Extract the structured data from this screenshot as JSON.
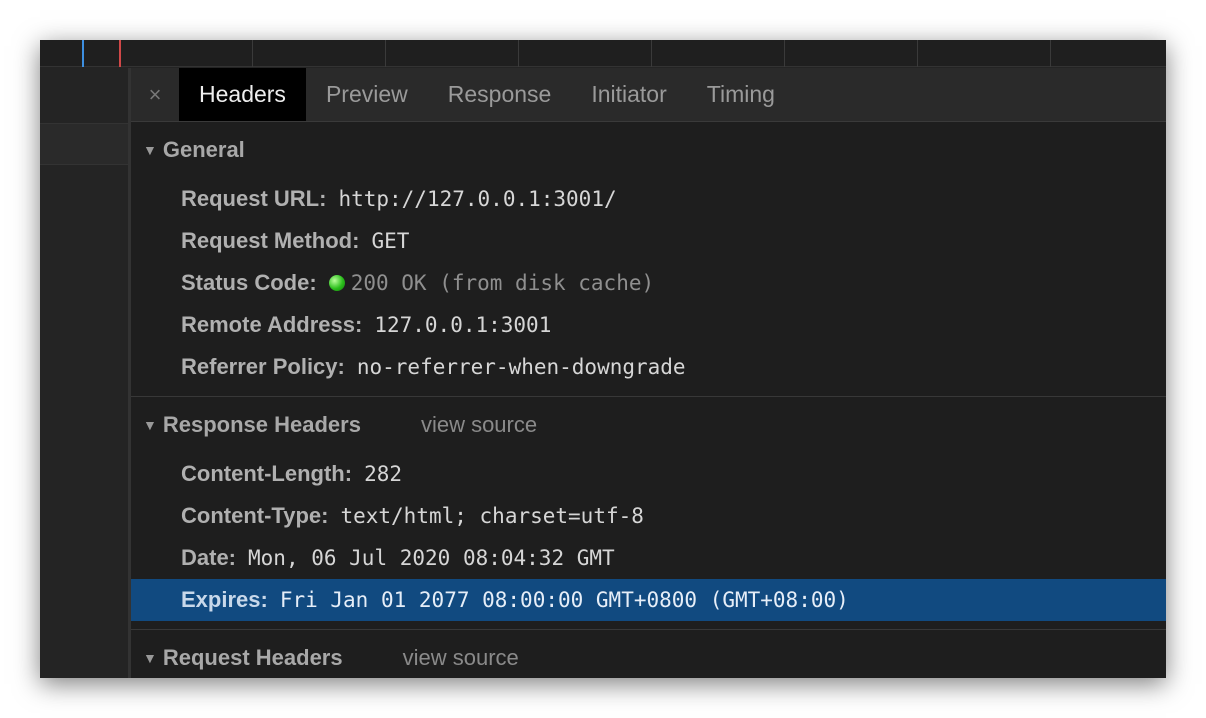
{
  "tabs": {
    "close": "×",
    "items": [
      "Headers",
      "Preview",
      "Response",
      "Initiator",
      "Timing"
    ],
    "active": "Headers"
  },
  "general": {
    "title": "General",
    "rows": [
      {
        "key": "Request URL:",
        "value": "http://127.0.0.1:3001/"
      },
      {
        "key": "Request Method:",
        "value": "GET"
      },
      {
        "key": "Status Code:",
        "value": "200 OK (from disk cache)",
        "status_color": "#2bbf1c"
      },
      {
        "key": "Remote Address:",
        "value": "127.0.0.1:3001"
      },
      {
        "key": "Referrer Policy:",
        "value": "no-referrer-when-downgrade"
      }
    ]
  },
  "response_headers": {
    "title": "Response Headers",
    "view_source": "view source",
    "rows": [
      {
        "key": "Content-Length:",
        "value": "282"
      },
      {
        "key": "Content-Type:",
        "value": "text/html; charset=utf-8"
      },
      {
        "key": "Date:",
        "value": "Mon, 06 Jul 2020 08:04:32 GMT"
      },
      {
        "key": "Expires:",
        "value": "Fri Jan 01 2077 08:00:00 GMT+0800 (GMT+08:00)",
        "selected": true
      }
    ]
  },
  "request_headers": {
    "title": "Request Headers",
    "view_source": "view source"
  },
  "colors": {
    "selection": "#114a80",
    "active_tab": "#000000"
  }
}
